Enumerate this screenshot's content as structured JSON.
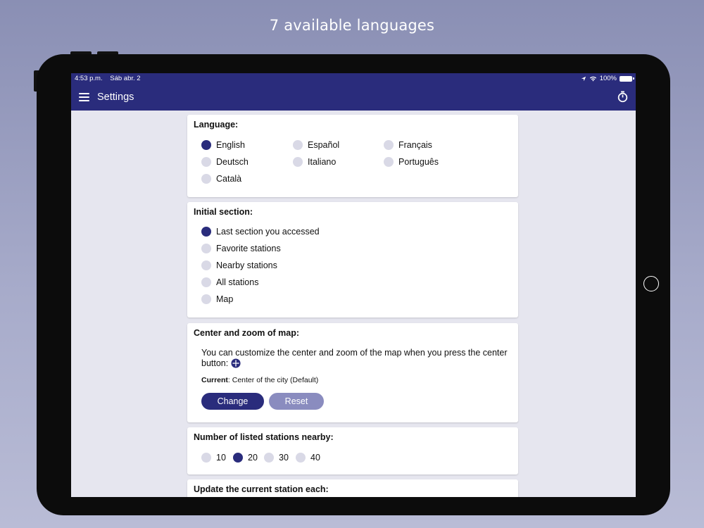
{
  "promo": {
    "caption": "7 available languages"
  },
  "status_bar": {
    "time": "4:53 p.m.",
    "date": "Sáb abr. 2",
    "battery": "100%"
  },
  "nav": {
    "title": "Settings",
    "menu_icon": "hamburger-menu-icon",
    "timer_icon": "stopwatch-icon"
  },
  "colors": {
    "primary": "#2a2c7c",
    "reset_button": "#8a8cbf",
    "radio_off": "#d9d9e6",
    "screen_bg": "#e6e6ef"
  },
  "language": {
    "title": "Language:",
    "options": [
      "English",
      "Español",
      "Français",
      "Deutsch",
      "Italiano",
      "Português",
      "Català"
    ],
    "selected": "English"
  },
  "initial_section": {
    "title": "Initial section:",
    "options": [
      "Last section you accessed",
      "Favorite stations",
      "Nearby stations",
      "All stations",
      "Map"
    ],
    "selected": "Last section you accessed"
  },
  "map_center": {
    "title": "Center and zoom of map:",
    "description": "You can customize the center and zoom of the map when you press the center button:",
    "current_label": "Current",
    "current_value": ": Center of the city (Default)",
    "change_label": "Change",
    "reset_label": "Reset"
  },
  "nearby_count": {
    "title": "Number of listed stations nearby:",
    "options": [
      "10",
      "20",
      "30",
      "40"
    ],
    "selected": "20"
  },
  "update_station": {
    "title": "Update the current station each:"
  }
}
